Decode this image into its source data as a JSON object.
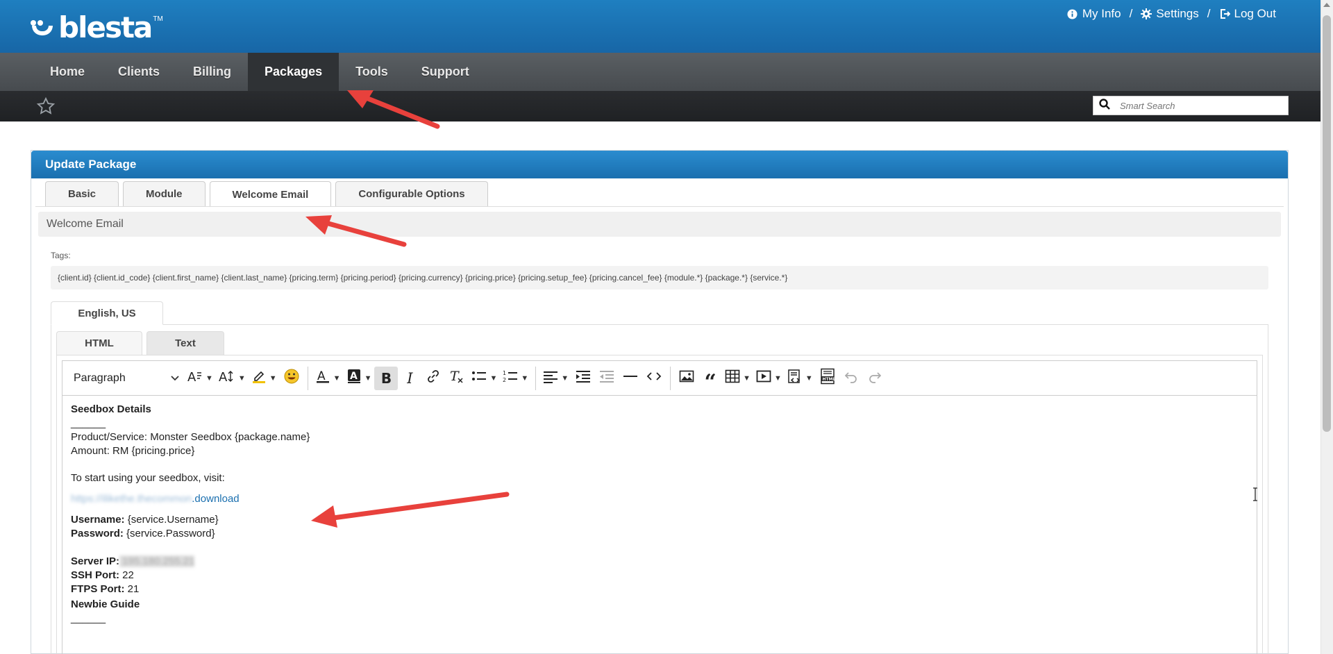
{
  "header": {
    "logo_text": "blesta",
    "logo_tm": "TM",
    "user_links": [
      {
        "label": "My Info",
        "icon": "info-icon"
      },
      {
        "label": "Settings",
        "icon": "gear-icon"
      },
      {
        "label": "Log Out",
        "icon": "logout-icon"
      }
    ],
    "separator": "/"
  },
  "nav": {
    "items": [
      "Home",
      "Clients",
      "Billing",
      "Packages",
      "Tools",
      "Support"
    ],
    "active": "Packages"
  },
  "search": {
    "placeholder": "Smart Search"
  },
  "panel": {
    "title": "Update Package",
    "tabs": [
      "Basic",
      "Module",
      "Welcome Email",
      "Configurable Options"
    ],
    "active_tab": "Welcome Email",
    "section_title": "Welcome Email",
    "tags_label": "Tags:",
    "tags": "{client.id} {client.id_code} {client.first_name} {client.last_name} {pricing.term} {pricing.period} {pricing.currency} {pricing.price} {pricing.setup_fee} {pricing.cancel_fee} {module.*} {package.*} {service.*}",
    "language_tab": "English, US",
    "format_tabs": [
      "HTML",
      "Text"
    ],
    "active_format": "HTML"
  },
  "editor": {
    "block_format": "Paragraph",
    "content": {
      "heading1": "Seedbox Details",
      "rule1": "______",
      "product_line": "Product/Service: Monster Seedbox {package.name}",
      "amount_line": "Amount: RM {pricing.price}",
      "visit_line": "To start using your seedbox, visit:",
      "url_hidden": "https://ilikethe.thecommon",
      "url_suffix": ".download",
      "username_label": "Username:",
      "username_value": " {service.Username}",
      "password_label": "Password:",
      "password_value": " {service.Password}",
      "server_ip_label": "Server IP:",
      "server_ip_hidden": " 195.180.255.21",
      "ssh_label": "SSH Port:",
      "ssh_value": " 22",
      "ftps_label": "FTPS Port:",
      "ftps_value": " 21",
      "heading2": "Newbie Guide",
      "rule2": "______"
    }
  },
  "colors": {
    "header_blue": "#1f7fc0",
    "nav_gray": "#4f5357",
    "arrow_red": "#e8413c"
  }
}
